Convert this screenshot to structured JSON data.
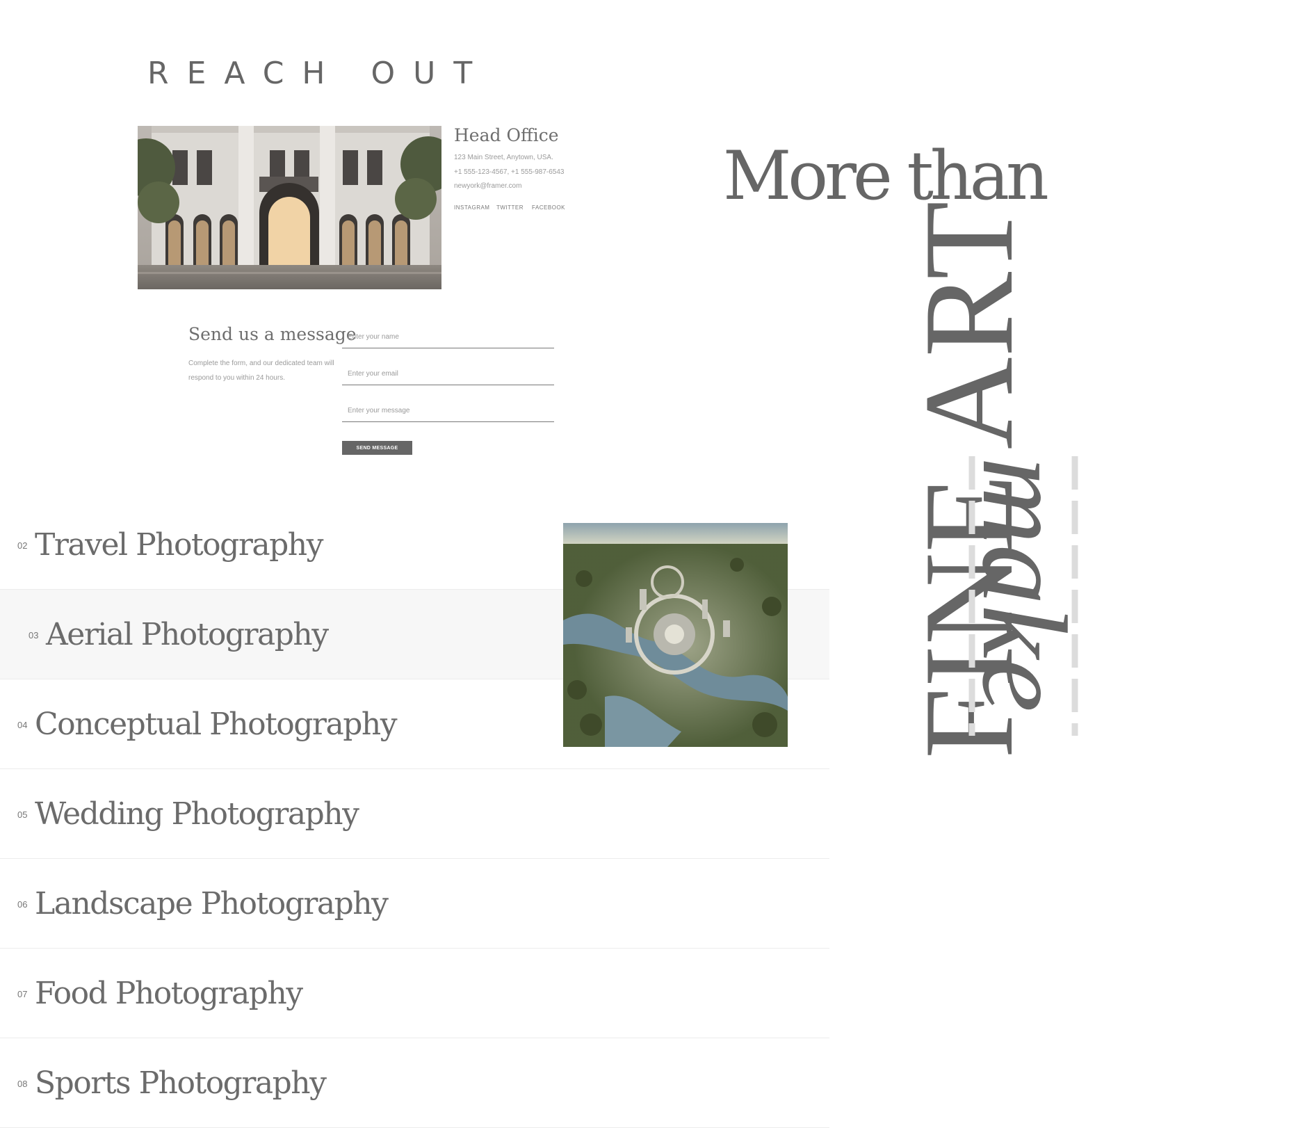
{
  "contact": {
    "heading": "REACH OUT",
    "office": {
      "title": "Head Office",
      "address": "123 Main Street, Anytown, USA.",
      "phones": "+1 555-123-4567, +1 555-987-6543",
      "email": "newyork@framer.com"
    },
    "social_links": [
      "INSTAGRAM",
      "TWITTER",
      "FACEBOOK"
    ],
    "form": {
      "title": "Send us a message",
      "description": "Complete the form, and our dedicated team will respond to you within 24 hours.",
      "name_placeholder": "Enter your name",
      "email_placeholder": "Enter your email",
      "message_placeholder": "Enter your message",
      "submit_label": "SEND MESSAGE"
    }
  },
  "services": [
    {
      "number": "02",
      "name": "Travel Photography"
    },
    {
      "number": "03",
      "name": "Aerial Photography"
    },
    {
      "number": "04",
      "name": "Conceptual Photography"
    },
    {
      "number": "05",
      "name": "Wedding Photography"
    },
    {
      "number": "06",
      "name": "Landscape Photography"
    },
    {
      "number": "07",
      "name": "Food Photography"
    },
    {
      "number": "08",
      "name": "Sports Photography"
    }
  ],
  "active_service": "03",
  "hero": {
    "line1": "More than",
    "line2": "FINE ART",
    "line3": "make"
  }
}
